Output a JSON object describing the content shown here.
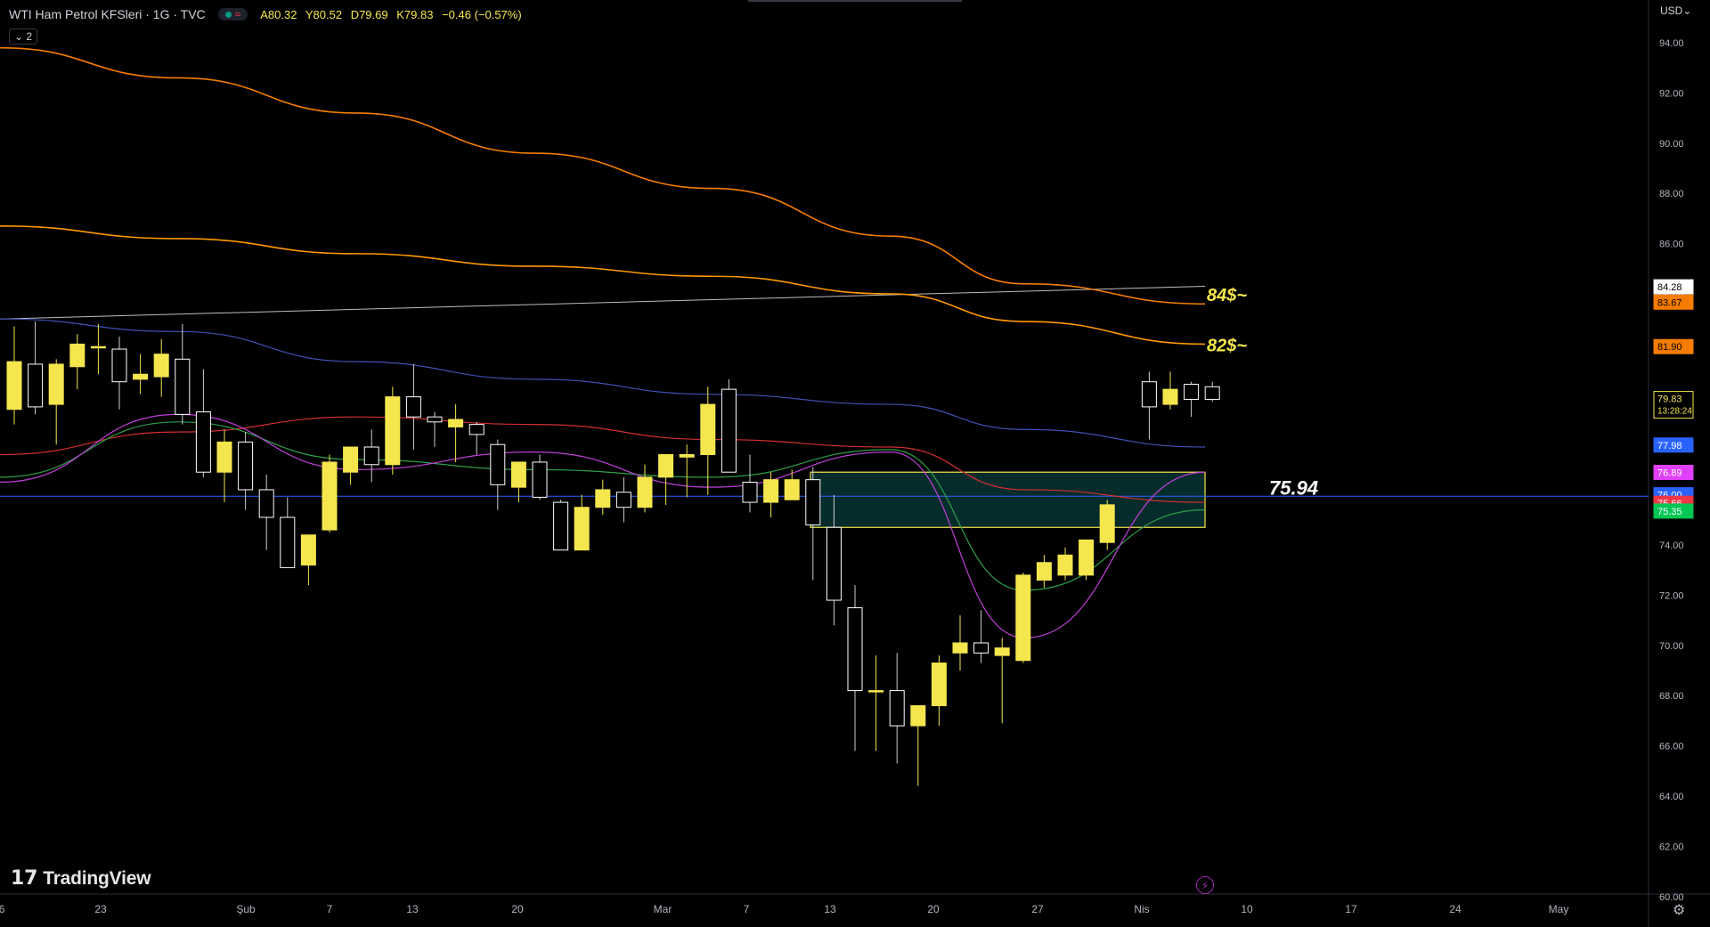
{
  "header": {
    "symbol_title": "WTI Ham Petrol KFSleri · 1G · TVC",
    "open": "A80.32",
    "high": "Y80.52",
    "low": "D79.69",
    "close": "K79.83",
    "change": "−0.46 (−0.57%)",
    "indicators_toggle": "⌄ 2"
  },
  "brand": {
    "logo_mark": "17",
    "logo_text": "TradingView"
  },
  "price_axis": {
    "currency": "USD⌄",
    "ticks": [
      "94.00",
      "92.00",
      "90.00",
      "88.00",
      "86.00",
      "84.00",
      "82.00",
      "80.00",
      "78.00",
      "76.00",
      "74.00",
      "72.00",
      "70.00",
      "68.00",
      "66.00",
      "64.00",
      "62.00",
      "60.00"
    ]
  },
  "time_axis": {
    "labels": [
      "6",
      "23",
      "Şub",
      "7",
      "13",
      "20",
      "Mar",
      "7",
      "13",
      "20",
      "27",
      "Nis",
      "10",
      "17",
      "24",
      "May"
    ]
  },
  "price_tags": [
    {
      "text": "84.28",
      "bg": "#ffffff",
      "fg": "#000000"
    },
    {
      "text": "83.67",
      "bg": "#f57c00",
      "fg": "#000000"
    },
    {
      "text": "81.90",
      "bg": "#f57c00",
      "fg": "#000000"
    },
    {
      "text": "79.83",
      "bg": "#000000",
      "fg": "#f5e64e",
      "sub": "13:28:24",
      "border": "#f5e64e"
    },
    {
      "text": "77.98",
      "bg": "#2962ff",
      "fg": "#ffffff"
    },
    {
      "text": "76.89",
      "bg": "#e040fb",
      "fg": "#ffffff"
    },
    {
      "text": "76.00",
      "bg": "#2962ff",
      "fg": "#ffffff"
    },
    {
      "text": "75.66",
      "bg": "#f23645",
      "fg": "#ffffff"
    },
    {
      "text": "75.35",
      "bg": "#00c853",
      "fg": "#ffffff"
    }
  ],
  "annotations": [
    {
      "text": "84$~",
      "color": "#f5e64e"
    },
    {
      "text": "82$~",
      "color": "#f5e64e"
    },
    {
      "text": "75.94",
      "color": "#ffffff"
    }
  ],
  "colors": {
    "background": "#000000",
    "bull_candle": "#f5e64e",
    "bear_candle": "#000000",
    "candle_outline": "#ffffff",
    "ma_200": "#f57c00",
    "ma_100": "#ff9800",
    "ma_50": "#3f51b5",
    "ma_20": "#d32f2f",
    "ma_10": "#2e9e49",
    "ma_5": "#c040d8",
    "level_line": "#2962ff",
    "zone": "#f5e64e",
    "trendline": "#bdbdbd"
  },
  "icons": {
    "flash": "flash-icon",
    "settings": "gear-icon"
  },
  "chart_data": {
    "type": "candlestick",
    "symbol": "WTI Ham Petrol KFSleri",
    "interval": "1G",
    "ylim": [
      60,
      95
    ],
    "candles": [
      {
        "o": 79.4,
        "h": 82.7,
        "l": 78.8,
        "c": 81.3
      },
      {
        "o": 81.2,
        "h": 82.9,
        "l": 79.2,
        "c": 79.5
      },
      {
        "o": 79.6,
        "h": 81.4,
        "l": 78.0,
        "c": 81.2
      },
      {
        "o": 81.1,
        "h": 82.4,
        "l": 80.2,
        "c": 82.0
      },
      {
        "o": 81.9,
        "h": 82.8,
        "l": 80.8,
        "c": 81.9
      },
      {
        "o": 81.8,
        "h": 82.3,
        "l": 79.4,
        "c": 80.5
      },
      {
        "o": 80.6,
        "h": 81.6,
        "l": 80.0,
        "c": 80.8
      },
      {
        "o": 80.7,
        "h": 82.2,
        "l": 79.9,
        "c": 81.6
      },
      {
        "o": 81.4,
        "h": 82.8,
        "l": 78.8,
        "c": 79.2
      },
      {
        "o": 79.3,
        "h": 81.0,
        "l": 76.7,
        "c": 76.9
      },
      {
        "o": 76.9,
        "h": 78.6,
        "l": 75.7,
        "c": 78.1
      },
      {
        "o": 78.1,
        "h": 78.5,
        "l": 75.4,
        "c": 76.2
      },
      {
        "o": 76.2,
        "h": 76.8,
        "l": 73.8,
        "c": 75.1
      },
      {
        "o": 75.1,
        "h": 75.9,
        "l": 73.1,
        "c": 73.1
      },
      {
        "o": 73.2,
        "h": 74.4,
        "l": 72.4,
        "c": 74.4
      },
      {
        "o": 74.6,
        "h": 77.6,
        "l": 74.5,
        "c": 77.3
      },
      {
        "o": 76.9,
        "h": 77.9,
        "l": 76.4,
        "c": 77.9
      },
      {
        "o": 77.9,
        "h": 78.6,
        "l": 76.5,
        "c": 77.2
      },
      {
        "o": 77.2,
        "h": 80.3,
        "l": 76.8,
        "c": 79.9
      },
      {
        "o": 79.9,
        "h": 81.2,
        "l": 77.8,
        "c": 79.1
      },
      {
        "o": 79.1,
        "h": 79.3,
        "l": 77.9,
        "c": 78.9
      },
      {
        "o": 78.7,
        "h": 79.6,
        "l": 77.3,
        "c": 79.0
      },
      {
        "o": 78.8,
        "h": 78.9,
        "l": 77.6,
        "c": 78.4
      },
      {
        "o": 78.0,
        "h": 78.2,
        "l": 75.4,
        "c": 76.4
      },
      {
        "o": 76.3,
        "h": 77.0,
        "l": 75.7,
        "c": 77.3
      },
      {
        "o": 77.3,
        "h": 77.6,
        "l": 75.8,
        "c": 75.9
      },
      {
        "o": 75.7,
        "h": 75.8,
        "l": 73.8,
        "c": 73.8
      },
      {
        "o": 73.8,
        "h": 76.0,
        "l": 73.8,
        "c": 75.5
      },
      {
        "o": 75.5,
        "h": 76.6,
        "l": 75.2,
        "c": 76.2
      },
      {
        "o": 76.1,
        "h": 76.7,
        "l": 74.9,
        "c": 75.5
      },
      {
        "o": 75.5,
        "h": 77.2,
        "l": 75.3,
        "c": 76.7
      },
      {
        "o": 76.7,
        "h": 77.4,
        "l": 75.6,
        "c": 77.6
      },
      {
        "o": 77.5,
        "h": 78.0,
        "l": 75.9,
        "c": 77.6
      },
      {
        "o": 77.6,
        "h": 80.3,
        "l": 76.0,
        "c": 79.6
      },
      {
        "o": 80.2,
        "h": 80.6,
        "l": 76.9,
        "c": 76.9
      },
      {
        "o": 76.5,
        "h": 77.6,
        "l": 75.3,
        "c": 75.7
      },
      {
        "o": 75.7,
        "h": 76.9,
        "l": 75.1,
        "c": 76.6
      },
      {
        "o": 75.8,
        "h": 77.0,
        "l": 75.8,
        "c": 76.6
      },
      {
        "o": 76.6,
        "h": 77.1,
        "l": 72.6,
        "c": 74.8
      },
      {
        "o": 74.7,
        "h": 76.0,
        "l": 70.8,
        "c": 71.8
      },
      {
        "o": 71.5,
        "h": 72.4,
        "l": 65.8,
        "c": 68.2
      },
      {
        "o": 68.2,
        "h": 69.6,
        "l": 65.8,
        "c": 68.2
      },
      {
        "o": 68.2,
        "h": 69.7,
        "l": 65.3,
        "c": 66.8
      },
      {
        "o": 66.8,
        "h": 67.1,
        "l": 64.4,
        "c": 67.6
      },
      {
        "o": 67.6,
        "h": 69.6,
        "l": 66.8,
        "c": 69.3
      },
      {
        "o": 69.7,
        "h": 71.2,
        "l": 69.0,
        "c": 70.1
      },
      {
        "o": 70.1,
        "h": 71.4,
        "l": 69.3,
        "c": 69.7
      },
      {
        "o": 69.6,
        "h": 70.3,
        "l": 66.9,
        "c": 69.9
      },
      {
        "o": 69.4,
        "h": 72.9,
        "l": 69.3,
        "c": 72.8
      },
      {
        "o": 72.6,
        "h": 73.6,
        "l": 72.3,
        "c": 73.3
      },
      {
        "o": 72.8,
        "h": 73.9,
        "l": 72.6,
        "c": 73.6
      },
      {
        "o": 72.8,
        "h": 74.1,
        "l": 72.6,
        "c": 74.2
      },
      {
        "o": 74.1,
        "h": 75.8,
        "l": 73.8,
        "c": 75.6
      },
      {
        "o": 80.5,
        "h": 80.9,
        "l": 78.2,
        "c": 79.5
      },
      {
        "o": 79.6,
        "h": 80.9,
        "l": 79.4,
        "c": 80.2
      },
      {
        "o": 80.4,
        "h": 80.5,
        "l": 79.1,
        "c": 79.8
      },
      {
        "o": 80.3,
        "h": 80.5,
        "l": 79.7,
        "c": 79.8
      }
    ],
    "moving_averages": [
      {
        "name": "200",
        "color": "#f57c00",
        "values": [
          93.8,
          92.6,
          91.2,
          89.6,
          88.2,
          86.3,
          84.4,
          83.6
        ]
      },
      {
        "name": "100",
        "color": "#ff9800",
        "values": [
          86.7,
          86.2,
          85.6,
          85.1,
          84.7,
          84.0,
          82.9,
          82.0
        ]
      },
      {
        "name": "50",
        "color": "#3f51b5",
        "values": [
          83.0,
          82.5,
          81.3,
          80.6,
          80.0,
          79.6,
          78.6,
          77.9
        ]
      },
      {
        "name": "20",
        "color": "#d32f2f",
        "values": [
          77.6,
          78.5,
          79.1,
          78.8,
          78.2,
          77.9,
          76.2,
          75.7
        ]
      },
      {
        "name": "10",
        "color": "#2e9e49",
        "values": [
          76.7,
          78.9,
          77.4,
          77.0,
          76.7,
          77.8,
          72.2,
          75.4
        ]
      },
      {
        "name": "5",
        "color": "#c040d8",
        "values": [
          76.5,
          79.2,
          77.0,
          77.7,
          76.3,
          77.7,
          70.3,
          76.9
        ]
      }
    ],
    "levels": [
      {
        "value": 75.94,
        "label": "75.94"
      }
    ],
    "zone": {
      "top": 76.9,
      "bottom": 74.7
    },
    "trendline": {
      "from": 83.0,
      "to": 84.3
    },
    "notes": [
      "84$~",
      "82$~"
    ]
  }
}
